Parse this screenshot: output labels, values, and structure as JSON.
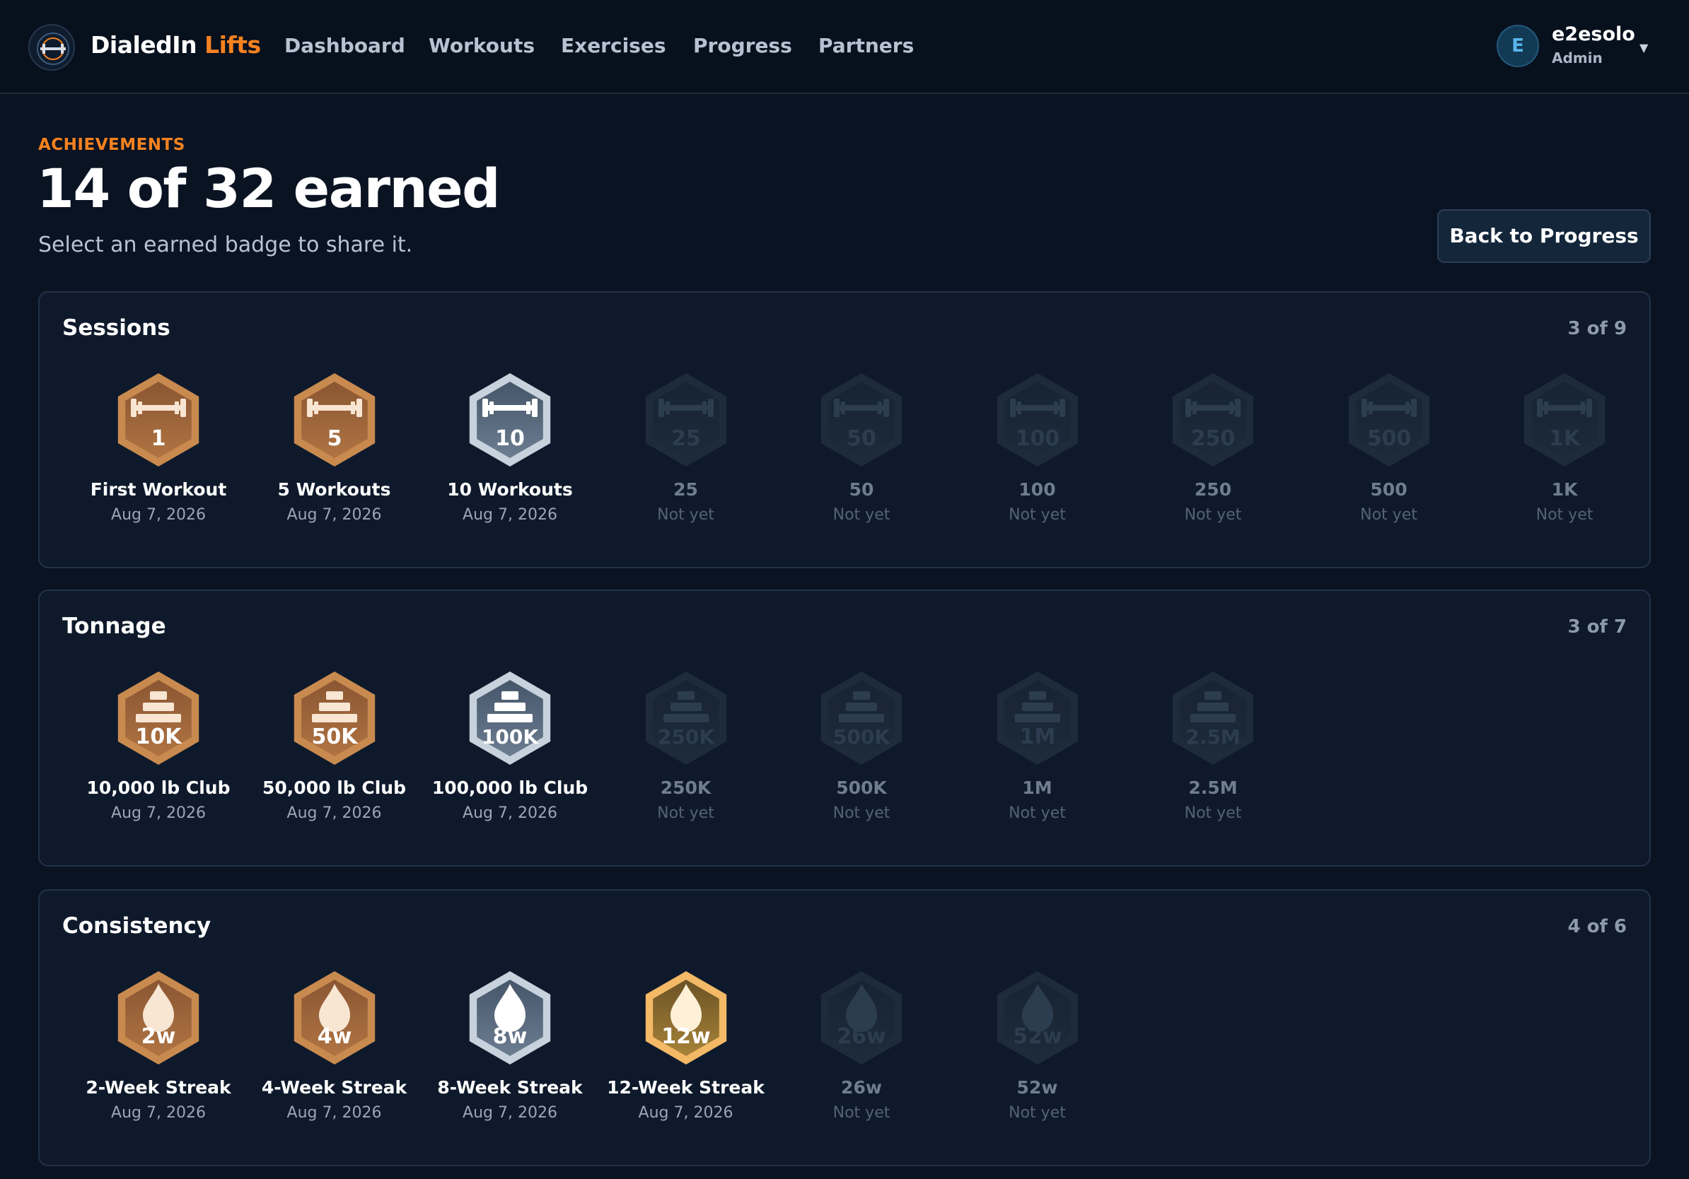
{
  "brand": {
    "part1": "DialedIn",
    "part2": "Lifts"
  },
  "nav": {
    "links": [
      "Dashboard",
      "Workouts",
      "Exercises",
      "Progress",
      "Partners"
    ]
  },
  "user": {
    "initial": "E",
    "name": "e2esolo",
    "role": "Admin",
    "caret": "▼"
  },
  "header": {
    "eyebrow": "ACHIEVEMENTS",
    "title": "14 of 32 earned",
    "subtitle": "Select an earned badge to share it.",
    "back_label": "Back to Progress"
  },
  "colors": {
    "bronze": "#c98a4f",
    "silver": "#c7d2dd",
    "gold": "#f3b966",
    "locked": "#233243",
    "accent": "#f58220"
  },
  "sections": [
    {
      "title": "Sessions",
      "count": "3 of 9",
      "icon": "barbell-icon",
      "badges": [
        {
          "label": "1",
          "name": "First Workout",
          "date": "Aug 7, 2026",
          "tier": "bronze"
        },
        {
          "label": "5",
          "name": "5 Workouts",
          "date": "Aug 7, 2026",
          "tier": "bronze"
        },
        {
          "label": "10",
          "name": "10 Workouts",
          "date": "Aug 7, 2026",
          "tier": "silver"
        },
        {
          "label": "25",
          "name": "25",
          "date": "Not yet",
          "tier": "locked"
        },
        {
          "label": "50",
          "name": "50",
          "date": "Not yet",
          "tier": "locked"
        },
        {
          "label": "100",
          "name": "100",
          "date": "Not yet",
          "tier": "locked"
        },
        {
          "label": "250",
          "name": "250",
          "date": "Not yet",
          "tier": "locked"
        },
        {
          "label": "500",
          "name": "500",
          "date": "Not yet",
          "tier": "locked"
        },
        {
          "label": "1K",
          "name": "1K",
          "date": "Not yet",
          "tier": "locked"
        }
      ]
    },
    {
      "title": "Tonnage",
      "count": "3 of 7",
      "icon": "plate-stack-icon",
      "badges": [
        {
          "label": "10K",
          "name": "10,000 lb Club",
          "date": "Aug 7, 2026",
          "tier": "bronze"
        },
        {
          "label": "50K",
          "name": "50,000 lb Club",
          "date": "Aug 7, 2026",
          "tier": "bronze"
        },
        {
          "label": "100K",
          "name": "100,000 lb Club",
          "date": "Aug 7, 2026",
          "tier": "silver"
        },
        {
          "label": "250K",
          "name": "250K",
          "date": "Not yet",
          "tier": "locked"
        },
        {
          "label": "500K",
          "name": "500K",
          "date": "Not yet",
          "tier": "locked"
        },
        {
          "label": "1M",
          "name": "1M",
          "date": "Not yet",
          "tier": "locked"
        },
        {
          "label": "2.5M",
          "name": "2.5M",
          "date": "Not yet",
          "tier": "locked"
        }
      ]
    },
    {
      "title": "Consistency",
      "count": "4 of 6",
      "icon": "flame-icon",
      "badges": [
        {
          "label": "2w",
          "name": "2-Week Streak",
          "date": "Aug 7, 2026",
          "tier": "bronze"
        },
        {
          "label": "4w",
          "name": "4-Week Streak",
          "date": "Aug 7, 2026",
          "tier": "bronze"
        },
        {
          "label": "8w",
          "name": "8-Week Streak",
          "date": "Aug 7, 2026",
          "tier": "silver"
        },
        {
          "label": "12w",
          "name": "12-Week Streak",
          "date": "Aug 7, 2026",
          "tier": "gold"
        },
        {
          "label": "26w",
          "name": "26w",
          "date": "Not yet",
          "tier": "locked"
        },
        {
          "label": "52w",
          "name": "52w",
          "date": "Not yet",
          "tier": "locked"
        }
      ]
    }
  ]
}
